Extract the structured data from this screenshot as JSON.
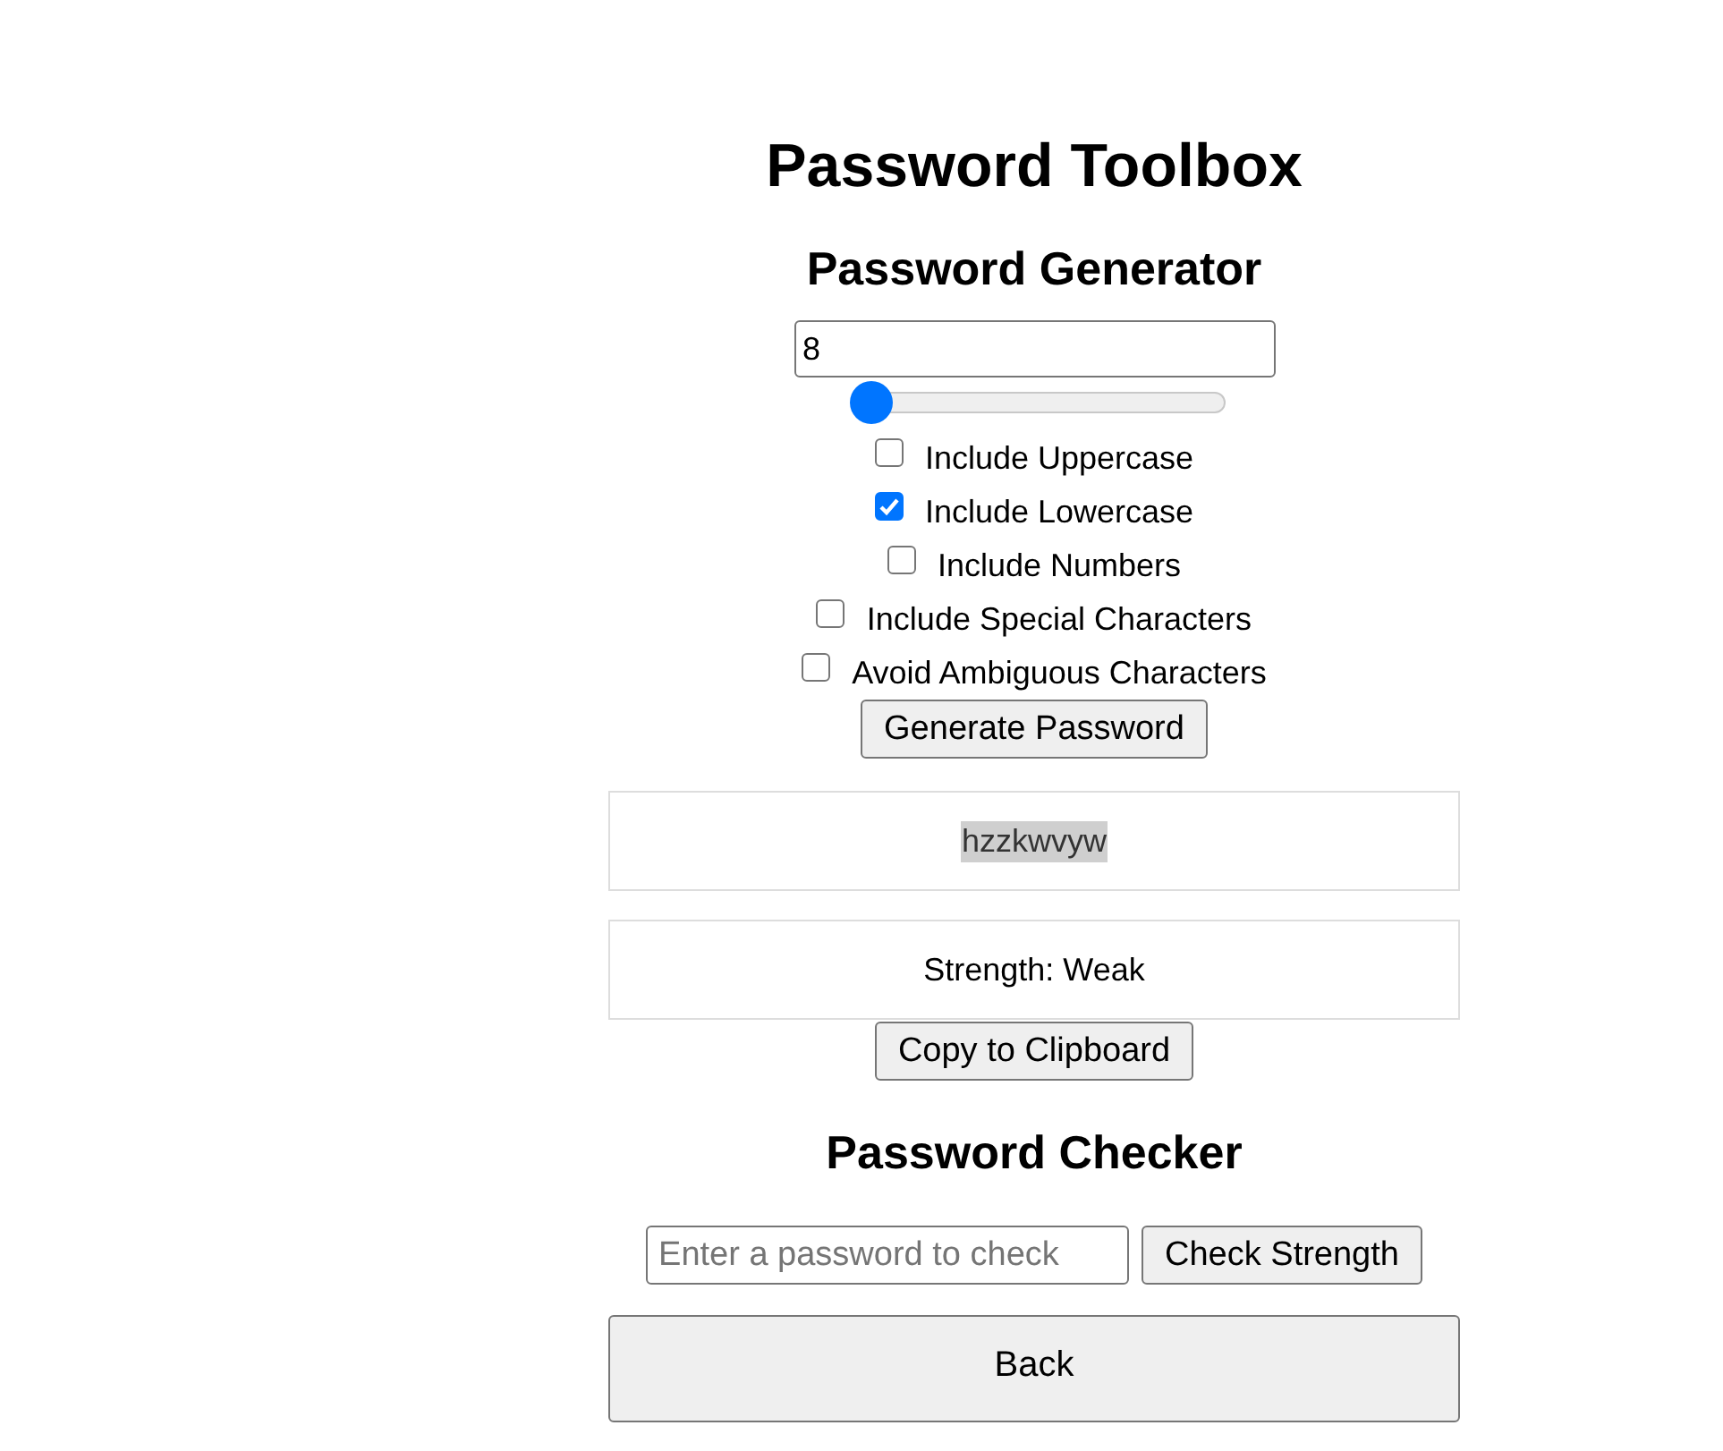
{
  "title": "Password Toolbox",
  "generator": {
    "heading": "Password Generator",
    "length_value": "8",
    "length_slider": {
      "level": 0
    },
    "options": [
      {
        "label": "Include Uppercase",
        "checked": false
      },
      {
        "label": "Include Lowercase",
        "checked": true
      },
      {
        "label": "Include Numbers",
        "checked": false
      },
      {
        "label": "Include Special Characters",
        "checked": false
      },
      {
        "label": "Avoid Ambiguous Characters",
        "checked": false
      }
    ],
    "generate_button": "Generate Password",
    "password": "hzzkwvyw",
    "strength": "Strength: Weak",
    "copy_button": "Copy to Clipboard"
  },
  "checker": {
    "heading": "Password Checker",
    "placeholder": "Enter a password to check",
    "check_button": "Check Strength"
  },
  "back_button": "Back"
}
